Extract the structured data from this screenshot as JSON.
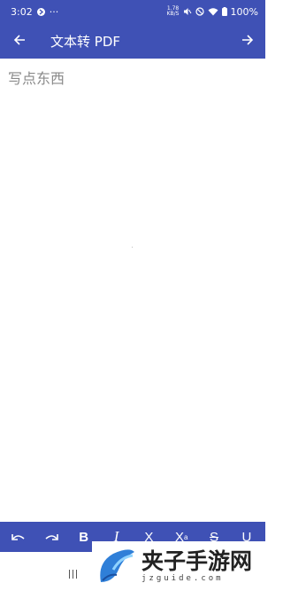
{
  "status_bar": {
    "time": "3:02",
    "notification_icon": "app-notification-icon",
    "more_indicator": "···",
    "data_speed": "1.78\nKB/S",
    "battery": "100%"
  },
  "app_bar": {
    "back_icon": "arrow-left-icon",
    "title": "文本转 PDF",
    "next_icon": "arrow-right-icon"
  },
  "editor": {
    "placeholder": "写点东西"
  },
  "toolbar": {
    "undo_icon": "undo-icon",
    "redo_icon": "redo-icon",
    "bold_label": "B",
    "italic_label": "I",
    "subscript_label": "X",
    "superscript_label": "X",
    "superscript_mark": "a",
    "strikethrough_label": "S",
    "underline_label": "U"
  },
  "watermark": {
    "main": "夹子手游网",
    "sub": "jzguide.com"
  },
  "colors": {
    "primary": "#3f51b5",
    "placeholder": "#8a8a8a",
    "background": "#ffffff"
  }
}
